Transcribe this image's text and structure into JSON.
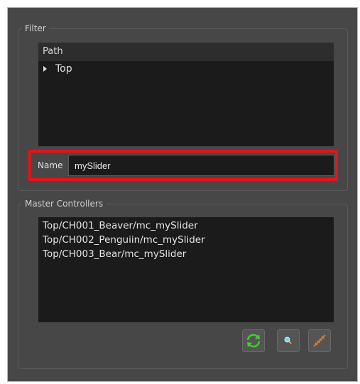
{
  "filter": {
    "title": "Filter",
    "tree": {
      "header": "Path",
      "items": [
        {
          "label": "Top"
        }
      ]
    },
    "name": {
      "label": "Name",
      "value": "mySlider"
    }
  },
  "master_controllers": {
    "title": "Master Controllers",
    "items": [
      "Top/CH001_Beaver/mc_mySlider",
      "Top/CH002_Penguiin/mc_mySlider",
      "Top/CH003_Bear/mc_mySlider"
    ],
    "buttons": [
      {
        "icon": "refresh-icon",
        "accent": "#3fd12a"
      },
      {
        "icon": "select-icon",
        "accent": "#6fd4ef"
      },
      {
        "icon": "link-icon",
        "accent": "#ff7b1a"
      }
    ]
  },
  "colors": {
    "highlight": "#e3141a",
    "panel": "#474747",
    "field": "#1b1b1b"
  }
}
